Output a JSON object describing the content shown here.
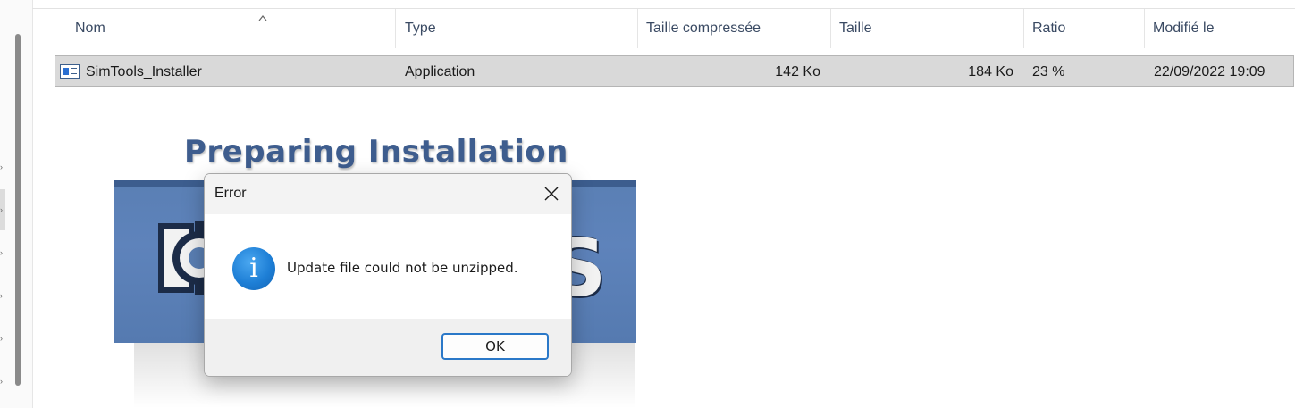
{
  "columns": {
    "name": "Nom",
    "type": "Type",
    "compressed": "Taille compressée",
    "size": "Taille",
    "ratio": "Ratio",
    "modified": "Modifié le"
  },
  "file_row": {
    "icon": "application-icon",
    "name": "SimTools_Installer",
    "type": "Application",
    "compressed": "142 Ko",
    "size": "184 Ko",
    "ratio": "23 %",
    "modified": "22/09/2022 19:09"
  },
  "splash": {
    "title": "Preparing Installation",
    "brand_letter": "S",
    "logo_icon": "gear-logo-icon"
  },
  "dialog": {
    "title": "Error",
    "message": "Update file could not be unzipped.",
    "icon": "info-icon",
    "ok_label": "OK"
  },
  "colors": {
    "header_text": "#3a4a63",
    "row_selected": "#d9d9d9",
    "banner_blue": "#5a7fb4",
    "title_blue": "#3e5d8e",
    "info_blue": "#1e7fd6",
    "button_border": "#2a78c8"
  }
}
